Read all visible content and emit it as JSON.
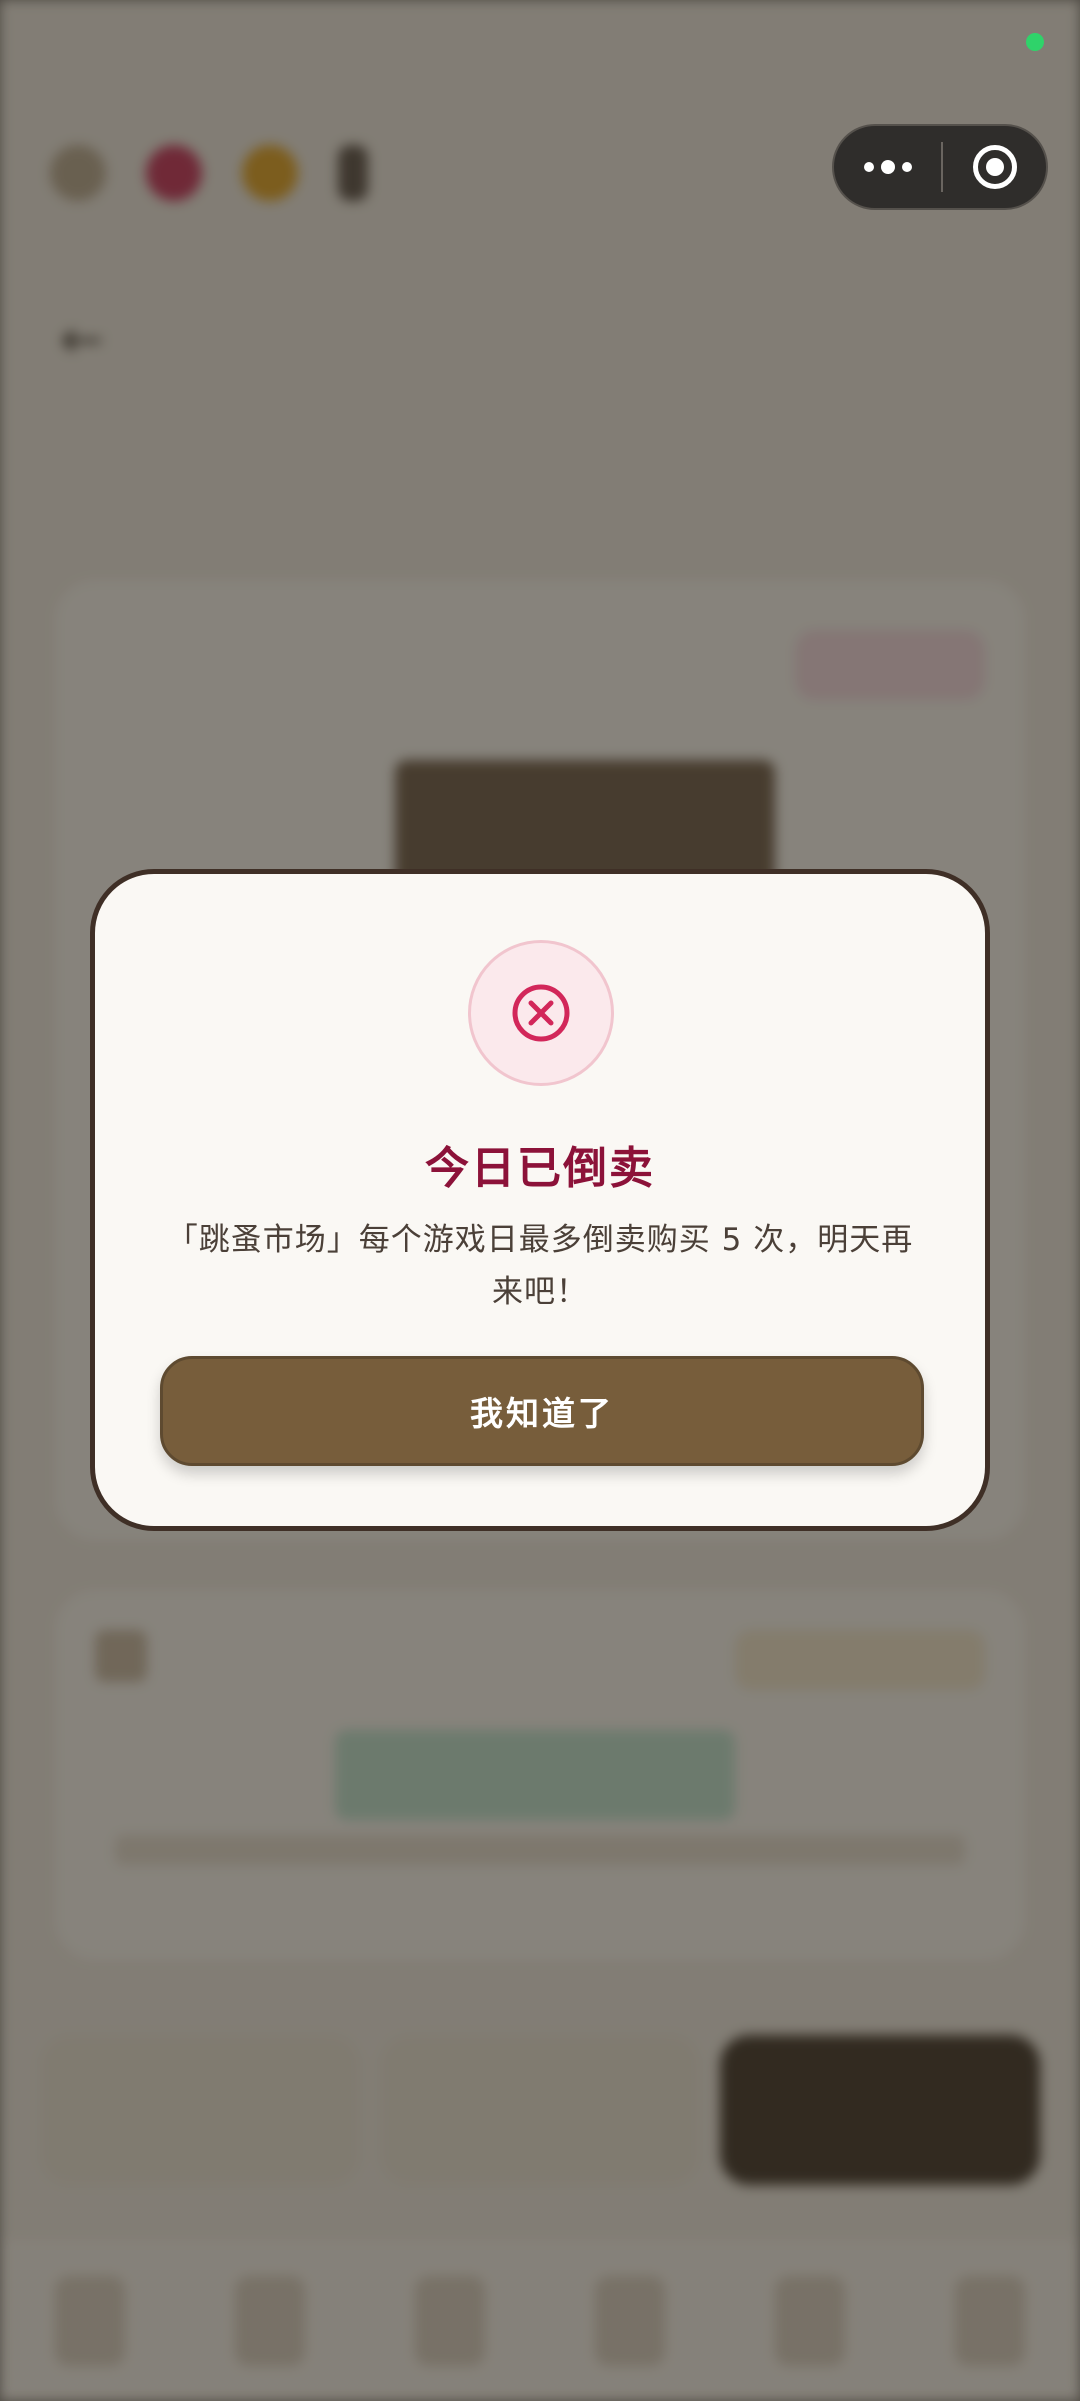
{
  "background": {
    "status_text": "",
    "page_title": "",
    "card_title": "",
    "card_badge": "",
    "card2_title": ""
  },
  "capsule": {
    "more_icon": "more-dots-icon",
    "close_icon": "target-circle-icon"
  },
  "dialog": {
    "icon": "error-x-circle-icon",
    "title": "今日已倒卖",
    "message": "「跳蚤市场」每个游戏日最多倒卖购买 5 次，明天再来吧！",
    "confirm_label": "我知道了"
  },
  "colors": {
    "title": "#8c1239",
    "button": "#775d3b",
    "icon_accent": "#d2275a",
    "status_dot": "#2fd36a"
  }
}
